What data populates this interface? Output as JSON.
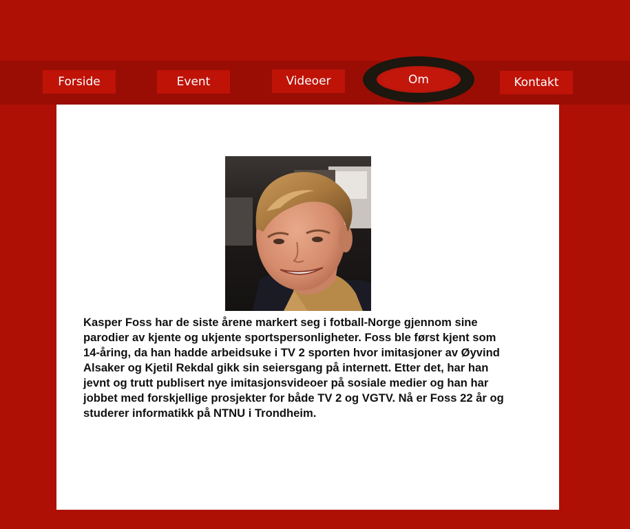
{
  "nav": {
    "forside": "Forside",
    "event": "Event",
    "videoer": "Videoer",
    "om": "Om",
    "kontakt": "Kontakt"
  },
  "about": {
    "bio_lines": [
      "Kasper Foss har de siste årene markert seg i fotball-Norge gjennom sine",
      "parodier av kjente og ukjente sportspersonligheter. Foss ble først kjent som",
      "14-åring, da han hadde arbeidsuke i TV 2 sporten hvor imitasjoner av Øyvind",
      "Alsaker og Kjetil Rekdal gikk sin seiersgang på internett. Etter det, har han",
      "jevnt og trutt publisert nye imitasjonsvideoer på sosiale medier og han har",
      "jobbet med forskjellige prosjekter for både TV 2 og VGTV. Nå er Foss 22 år og",
      "studerer informatikk på NTNU i Trondheim."
    ]
  },
  "colors": {
    "background": "#af1006",
    "navbar": "#9a0d04",
    "nav_button": "#bf1308",
    "active_ring": "#1c170f",
    "card": "#ffffff"
  }
}
